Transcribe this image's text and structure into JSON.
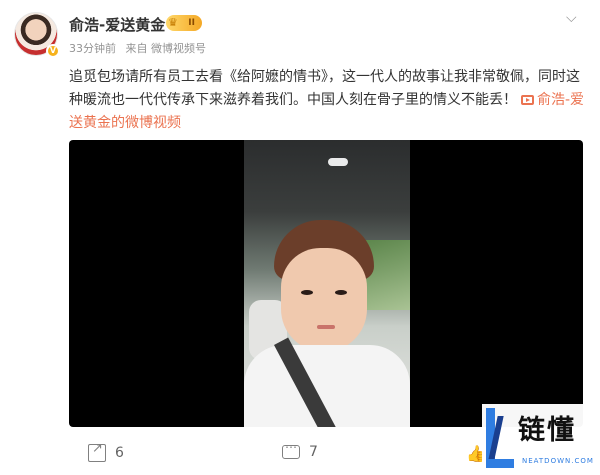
{
  "post": {
    "author": "俞浩-爱送黄金",
    "vip_level": "II",
    "time": "33分钟前",
    "source": "来自 微博视频号",
    "text": "追觅包场请所有员工去看《给阿嬷的情书》，这一代人的故事让我非常敬佩，同时这种暖流也一代代传承下来滋养着我们。中国人刻在骨子里的情义不能丢！",
    "link_text": "俞浩-爱送黄金的微博视频",
    "avatar_badge": "V"
  },
  "actions": {
    "share_count": "6",
    "comment_count": "7"
  },
  "watermark": {
    "title": "链懂",
    "subtitle": "NEATDOWN.COM"
  },
  "colors": {
    "link": "#eb7350",
    "text": "#333333",
    "meta": "#939393",
    "vip": "#f4a826",
    "brand_blue": "#2f7de1"
  },
  "icons": [
    "more-icon",
    "link-video-icon",
    "share-icon",
    "comment-icon",
    "like-icon",
    "vip-crown-icon"
  ]
}
